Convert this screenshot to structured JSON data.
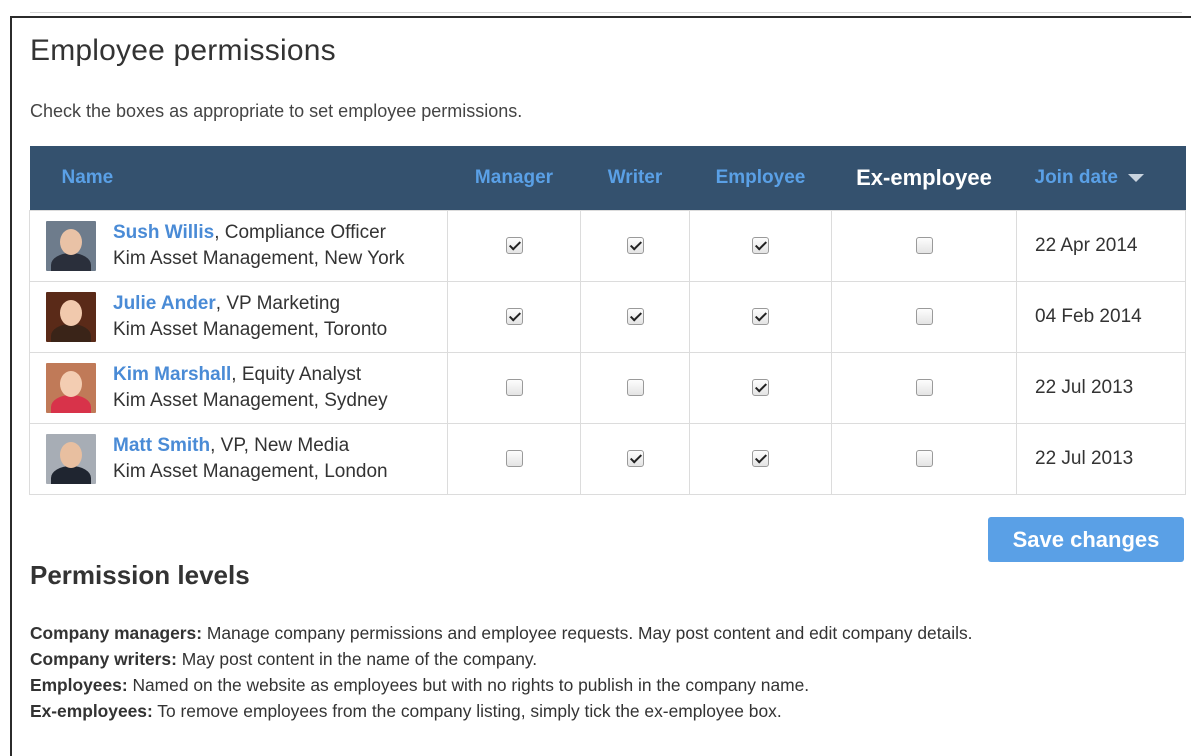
{
  "page": {
    "title": "Employee permissions",
    "intro": "Check the boxes as appropriate to set employee permissions."
  },
  "table": {
    "headers": {
      "name": "Name",
      "manager": "Manager",
      "writer": "Writer",
      "employee": "Employee",
      "ex_employee": "Ex-employee",
      "join_date": "Join date"
    },
    "rows": [
      {
        "name": "Sush Willis",
        "role": ", Compliance Officer",
        "company": "Kim Asset Management, New York",
        "manager": true,
        "writer": true,
        "employee": true,
        "ex_employee": false,
        "join_date": "22 Apr 2014",
        "avatar": {
          "face": "#e9c2a6",
          "body": "#2a2f3b",
          "bg": "#6e7c8c"
        }
      },
      {
        "name": "Julie Ander",
        "role": ", VP Marketing",
        "company": "Kim Asset Management, Toronto",
        "manager": true,
        "writer": true,
        "employee": true,
        "ex_employee": false,
        "join_date": "04 Feb 2014",
        "avatar": {
          "face": "#f1c9ad",
          "body": "#3a2418",
          "bg": "#5a2a18"
        }
      },
      {
        "name": "Kim Marshall",
        "role": ", Equity Analyst",
        "company": "Kim Asset Management, Sydney",
        "manager": false,
        "writer": false,
        "employee": true,
        "ex_employee": false,
        "join_date": "22 Jul 2013",
        "avatar": {
          "face": "#f3cdb2",
          "body": "#d8334a",
          "bg": "#c07a58"
        }
      },
      {
        "name": "Matt Smith",
        "role": ", VP, New Media",
        "company": "Kim Asset Management, London",
        "manager": false,
        "writer": true,
        "employee": true,
        "ex_employee": false,
        "join_date": "22 Jul 2013",
        "avatar": {
          "face": "#e8bfa0",
          "body": "#1f2530",
          "bg": "#a7adb5"
        }
      }
    ]
  },
  "save_button": {
    "label": "Save changes"
  },
  "levels": {
    "title": "Permission levels",
    "items": [
      {
        "term": "Company managers:",
        "desc": " Manage company permissions and employee requests. May post content and edit company details."
      },
      {
        "term": "Company writers:",
        "desc": " May post content in the name of the company."
      },
      {
        "term": "Employees:",
        "desc": " Named on the website as employees but with no rights to publish in the company name."
      },
      {
        "term": "Ex-employees:",
        "desc": " To remove employees from the company listing, simply tick the ex-employee box."
      }
    ]
  },
  "icons": {
    "avatar": "person-photo",
    "sort": "caret-down-icon",
    "check": "checkbox"
  },
  "colors": {
    "header_bg": "#34516e",
    "header_text": "#5aa0e6",
    "link": "#4a8bd6",
    "button": "#5aa0e6"
  }
}
